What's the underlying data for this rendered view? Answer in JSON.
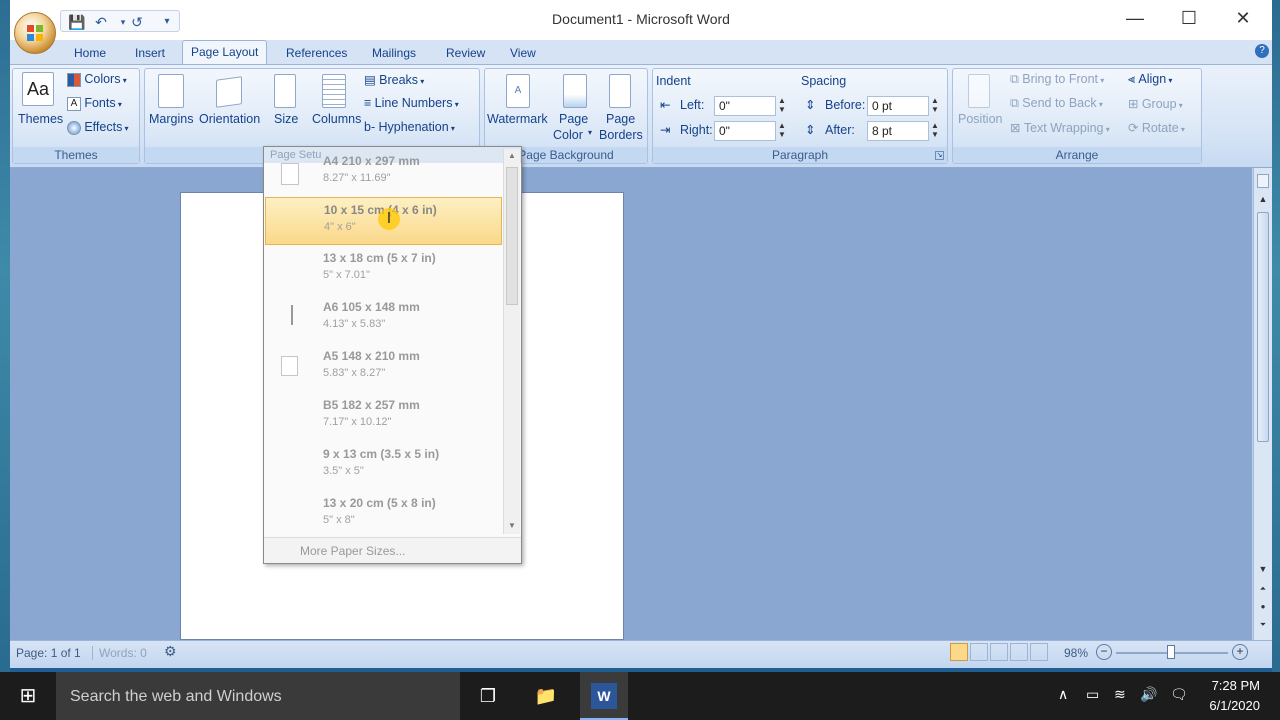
{
  "window": {
    "title": "Document1 - Microsoft Word",
    "minimize_glyph": "—",
    "maximize_glyph": "☐",
    "close_glyph": "✕"
  },
  "quick_access": {
    "save_icon": "save-icon",
    "undo_icon": "undo-icon",
    "redo_icon": "redo-icon",
    "customize_icon": "customize-icon"
  },
  "tabs": [
    "Home",
    "Insert",
    "Page Layout",
    "References",
    "Mailings",
    "Review",
    "View"
  ],
  "active_tab": "Page Layout",
  "ribbon": {
    "themes": {
      "themes_label": "Themes",
      "colors_label": "Colors",
      "fonts_label": "Fonts",
      "effects_label": "Effects",
      "group_label": "Themes"
    },
    "page_setup": {
      "margins_label": "Margins",
      "orientation_label": "Orientation",
      "size_label": "Size",
      "columns_label": "Columns",
      "breaks_label": "Breaks",
      "line_numbers_label": "Line Numbers",
      "hyphenation_label": "Hyphenation",
      "group_label": "Page Setup"
    },
    "page_background": {
      "watermark_label": "Watermark",
      "page_color_label_1": "Page",
      "page_color_label_2": "Color",
      "page_borders_label_1": "Page",
      "page_borders_label_2": "Borders",
      "group_label": "Page Background"
    },
    "paragraph": {
      "indent_label": "Indent",
      "left_label": "Left:",
      "left_value": "0\"",
      "right_label": "Right:",
      "right_value": "0\"",
      "spacing_label": "Spacing",
      "before_label": "Before:",
      "before_value": "0 pt",
      "after_label": "After:",
      "after_value": "8 pt",
      "group_label": "Paragraph"
    },
    "arrange": {
      "position_label": "Position",
      "bring_to_front_label": "Bring to Front",
      "send_to_back_label": "Send to Back",
      "text_wrapping_label": "Text Wrapping",
      "align_label": "Align",
      "group_label": "Group",
      "rotate_label": "Rotate",
      "arrange_label": "Arrange"
    }
  },
  "size_dropdown": {
    "header": "Page Setu",
    "items": [
      {
        "name": "A4 210 x 297 mm",
        "dims": "8.27\" x 11.69\""
      },
      {
        "name": "10 x 15 cm (4 x 6 in)",
        "dims": "4\" x 6\""
      },
      {
        "name": "13 x 18 cm (5 x 7 in)",
        "dims": "5\" x 7.01\""
      },
      {
        "name": "A6 105 x 148 mm",
        "dims": "4.13\" x 5.83\""
      },
      {
        "name": "A5 148 x 210 mm",
        "dims": "5.83\" x 8.27\""
      },
      {
        "name": "B5 182 x 257 mm",
        "dims": "7.17\" x 10.12\""
      },
      {
        "name": "9 x 13 cm (3.5 x 5 in)",
        "dims": "3.5\" x 5\""
      },
      {
        "name": "13 x 20 cm (5 x 8 in)",
        "dims": "5\" x 8\""
      }
    ],
    "highlighted_index": 1,
    "more_label": "More Paper Sizes..."
  },
  "status_bar": {
    "page": "Page: 1 of 1",
    "words": "Words: 0",
    "zoom": "98%"
  },
  "taskbar": {
    "search_placeholder": "Search the web and Windows",
    "time": "7:28 PM",
    "date": "6/1/2020"
  }
}
